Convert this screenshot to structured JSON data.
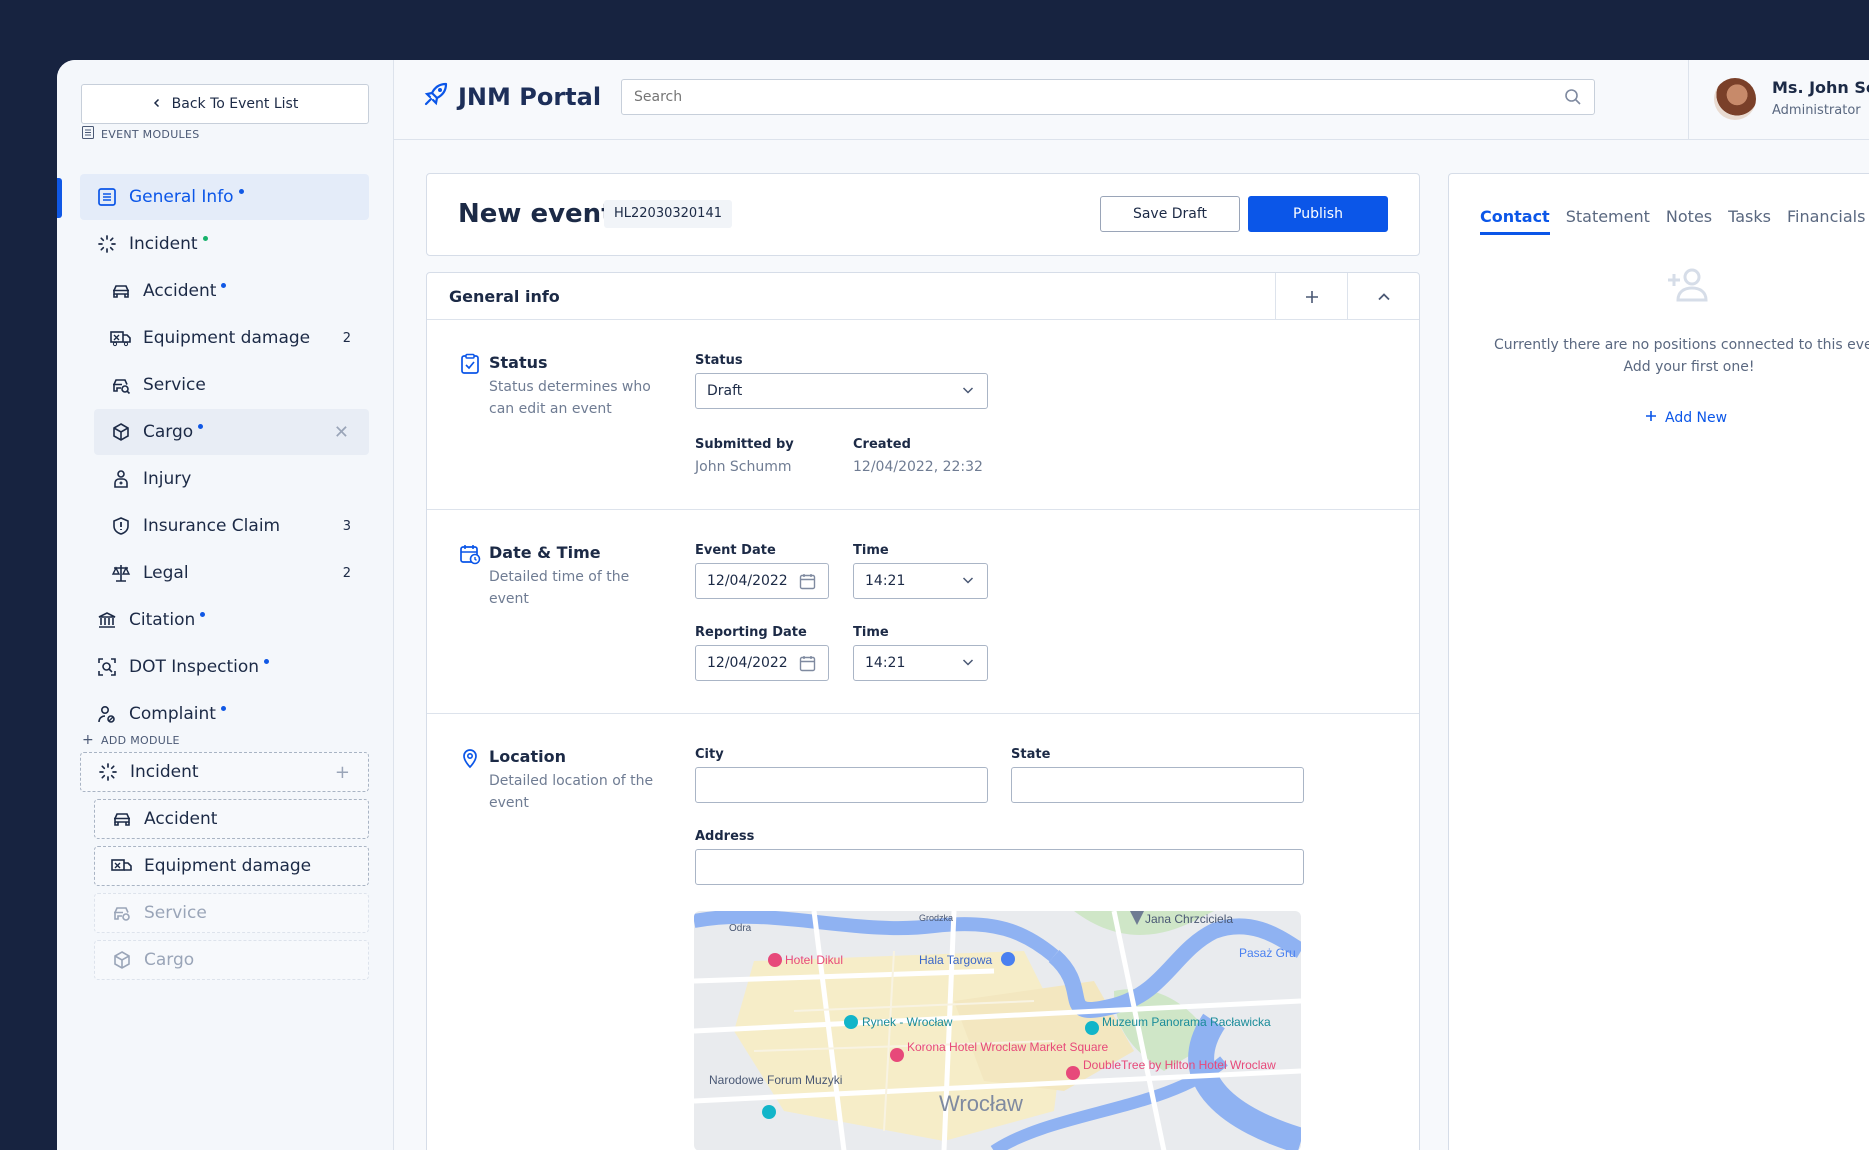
{
  "sidebar": {
    "back_label": "Back To Event List",
    "modules_heading": "EVENT MODULES",
    "modules": [
      {
        "label": "General Info",
        "icon": "document-icon",
        "dot": "blue"
      },
      {
        "label": "Incident",
        "icon": "spinner-icon",
        "dot": "green"
      },
      {
        "label": "Accident",
        "icon": "car-icon",
        "dot": "blue"
      },
      {
        "label": "Equipment damage",
        "icon": "truck-damage-icon",
        "count": "2"
      },
      {
        "label": "Service",
        "icon": "car-search-icon"
      },
      {
        "label": "Cargo",
        "icon": "box-icon",
        "dot": "blue"
      },
      {
        "label": "Injury",
        "icon": "injury-icon"
      },
      {
        "label": "Insurance Claim",
        "icon": "shield-icon",
        "count": "3"
      },
      {
        "label": "Legal",
        "icon": "scales-icon",
        "count": "2"
      },
      {
        "label": "Citation",
        "icon": "bank-icon",
        "dot": "blue"
      },
      {
        "label": "DOT Inspection",
        "icon": "inspection-icon",
        "dot": "blue"
      },
      {
        "label": "Complaint",
        "icon": "user-complaint-icon",
        "dot": "blue"
      }
    ],
    "add_heading": "ADD MODULE",
    "add_modules": [
      {
        "label": "Incident"
      },
      {
        "label": "Accident"
      },
      {
        "label": "Equipment damage"
      },
      {
        "label": "Service"
      },
      {
        "label": "Cargo"
      }
    ]
  },
  "header": {
    "app_name": "JNM Portal",
    "search_placeholder": "Search",
    "user_name": "Ms. John Schumm",
    "user_role": "Administrator"
  },
  "event": {
    "title": "New event",
    "id": "HL22030320141",
    "save_draft": "Save Draft",
    "publish": "Publish"
  },
  "general": {
    "section_title": "General info",
    "status": {
      "title": "Status",
      "desc": "Status determines who can edit an event",
      "field_label": "Status",
      "value": "Draft",
      "submitted_label": "Submitted by",
      "submitted_value": "John Schumm",
      "created_label": "Created",
      "created_value": "12/04/2022, 22:32"
    },
    "datetime": {
      "title": "Date & Time",
      "desc": "Detailed time of the event",
      "event_date_label": "Event Date",
      "event_date": "12/04/2022",
      "time_label": "Time",
      "event_time": "14:21",
      "reporting_date_label": "Reporting Date",
      "reporting_date": "12/04/2022",
      "reporting_time": "14:21"
    },
    "location": {
      "title": "Location",
      "desc": "Detailed location of the event",
      "city_label": "City",
      "city": "",
      "state_label": "State",
      "state": "",
      "address_label": "Address",
      "address": ""
    }
  },
  "map": {
    "labels": {
      "hotel_dikul": "Hotel Dikul",
      "hala": "Hala Targowa",
      "jana": "Jana Chrzciciela",
      "pasaz": "Pasaż Gru",
      "rynek": "Rynek - Wrocław",
      "muzeum": "Muzeum Panorama Racławicka",
      "korona": "Korona Hotel Wroclaw Market Square",
      "narodowe": "Narodowe Forum Muzyki",
      "doubletree": "DoubleTree by Hilton Hotel Wroclaw",
      "wroclaw": "Wrocław",
      "odra": "Odra",
      "grodzka": "Grodzka"
    }
  },
  "right_panel": {
    "tabs": [
      "Contact",
      "Statement",
      "Notes",
      "Tasks",
      "Financials"
    ],
    "empty_line1": "Currently there are no positions connected to this eve",
    "empty_line2": "Add your first one!",
    "add_new": "Add New"
  },
  "colors": {
    "primary": "#0b56e8",
    "navy": "#172340",
    "dot_green": "#16b26b"
  }
}
